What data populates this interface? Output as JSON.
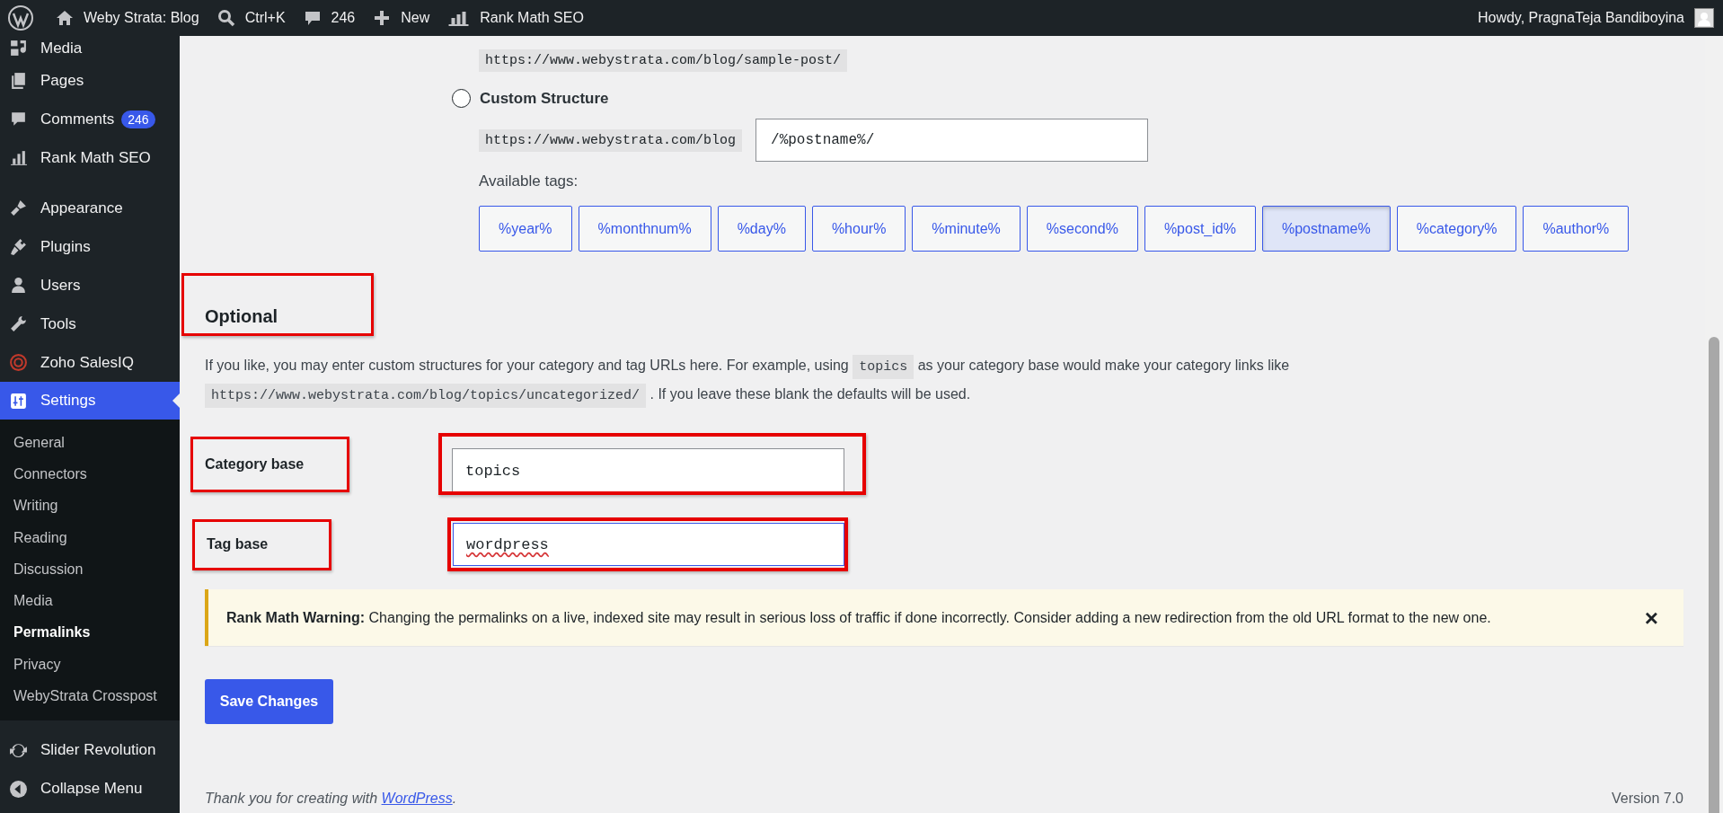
{
  "admin_bar": {
    "site_title": "Weby Strata: Blog",
    "search_shortcut": "Ctrl+K",
    "comments_count": "246",
    "new_label": "New",
    "seo_label": "Rank Math SEO",
    "greeting": "Howdy, PragnaTeja Bandiboyina"
  },
  "sidebar": {
    "groups": [
      {
        "items": [
          {
            "label": "Media",
            "selected": false
          },
          {
            "label": "Pages",
            "selected": false
          },
          {
            "label": "Comments",
            "badge": "246",
            "selected": false
          },
          {
            "label": "Rank Math SEO",
            "selected": false
          }
        ]
      },
      {
        "items": [
          {
            "label": "Appearance",
            "selected": false
          },
          {
            "label": "Plugins",
            "selected": false
          },
          {
            "label": "Users",
            "selected": false
          },
          {
            "label": "Tools",
            "selected": false
          },
          {
            "label": "Zoho SalesIQ",
            "selected": false
          },
          {
            "label": "Settings",
            "selected": true,
            "children": [
              {
                "label": "General",
                "selected": false
              },
              {
                "label": "Connectors",
                "selected": false
              },
              {
                "label": "Writing",
                "selected": false
              },
              {
                "label": "Reading",
                "selected": false
              },
              {
                "label": "Discussion",
                "selected": false
              },
              {
                "label": "Media",
                "selected": false
              },
              {
                "label": "Permalinks",
                "selected": true
              },
              {
                "label": "Privacy",
                "selected": false
              },
              {
                "label": "WebyStrata Crosspost",
                "selected": false
              }
            ]
          }
        ]
      },
      {
        "items": [
          {
            "label": "Slider Revolution",
            "selected": false
          },
          {
            "label": "Collapse Menu",
            "selected": false
          }
        ]
      }
    ]
  },
  "structure": {
    "sample_url": "https://www.webystrata.com/blog/sample-post/",
    "custom": {
      "label": "Custom Structure",
      "selected": false,
      "prefix": "https://www.webystrata.com/blog",
      "value": "/%postname%/"
    },
    "tags_label": "Available tags:",
    "tags": [
      {
        "label": "%year%",
        "selected": false
      },
      {
        "label": "%monthnum%",
        "selected": false
      },
      {
        "label": "%day%",
        "selected": false
      },
      {
        "label": "%hour%",
        "selected": false
      },
      {
        "label": "%minute%",
        "selected": false
      },
      {
        "label": "%second%",
        "selected": false
      },
      {
        "label": "%post_id%",
        "selected": false
      },
      {
        "label": "%postname%",
        "selected": true
      },
      {
        "label": "%category%",
        "selected": false
      },
      {
        "label": "%author%",
        "selected": false
      }
    ]
  },
  "optional": {
    "heading": "Optional",
    "highlighted": true,
    "description": [
      [
        {
          "kind": "text",
          "text": "If you like, you may enter custom structures for your category and tag URLs here. For example, using "
        },
        {
          "kind": "code",
          "text": "topics"
        },
        {
          "kind": "text",
          "text": " as your category base would make your category links like"
        }
      ],
      [
        {
          "kind": "code",
          "text": "https://www.webystrata.com/blog/topics/uncategorized/"
        },
        {
          "kind": "text",
          "text": " . If you leave these blank the defaults will be used."
        }
      ]
    ],
    "fields": [
      {
        "label": "Category base",
        "value": "topics",
        "highlighted": true,
        "misspelled": false
      },
      {
        "label": "Tag base",
        "value": "wordpress",
        "highlighted": true,
        "misspelled": true
      }
    ]
  },
  "notice": {
    "title": "Rank Math Warning:",
    "message": "Changing the permalinks on a live, indexed site may result in serious loss of traffic if done incorrectly. Consider adding a new redirection from the old URL format to the new one.",
    "close": "×"
  },
  "save_button": "Save Changes",
  "footer": {
    "prefix": "Thank you for creating with ",
    "link": "WordPress",
    "suffix": ".",
    "version": "Version 7.0"
  }
}
